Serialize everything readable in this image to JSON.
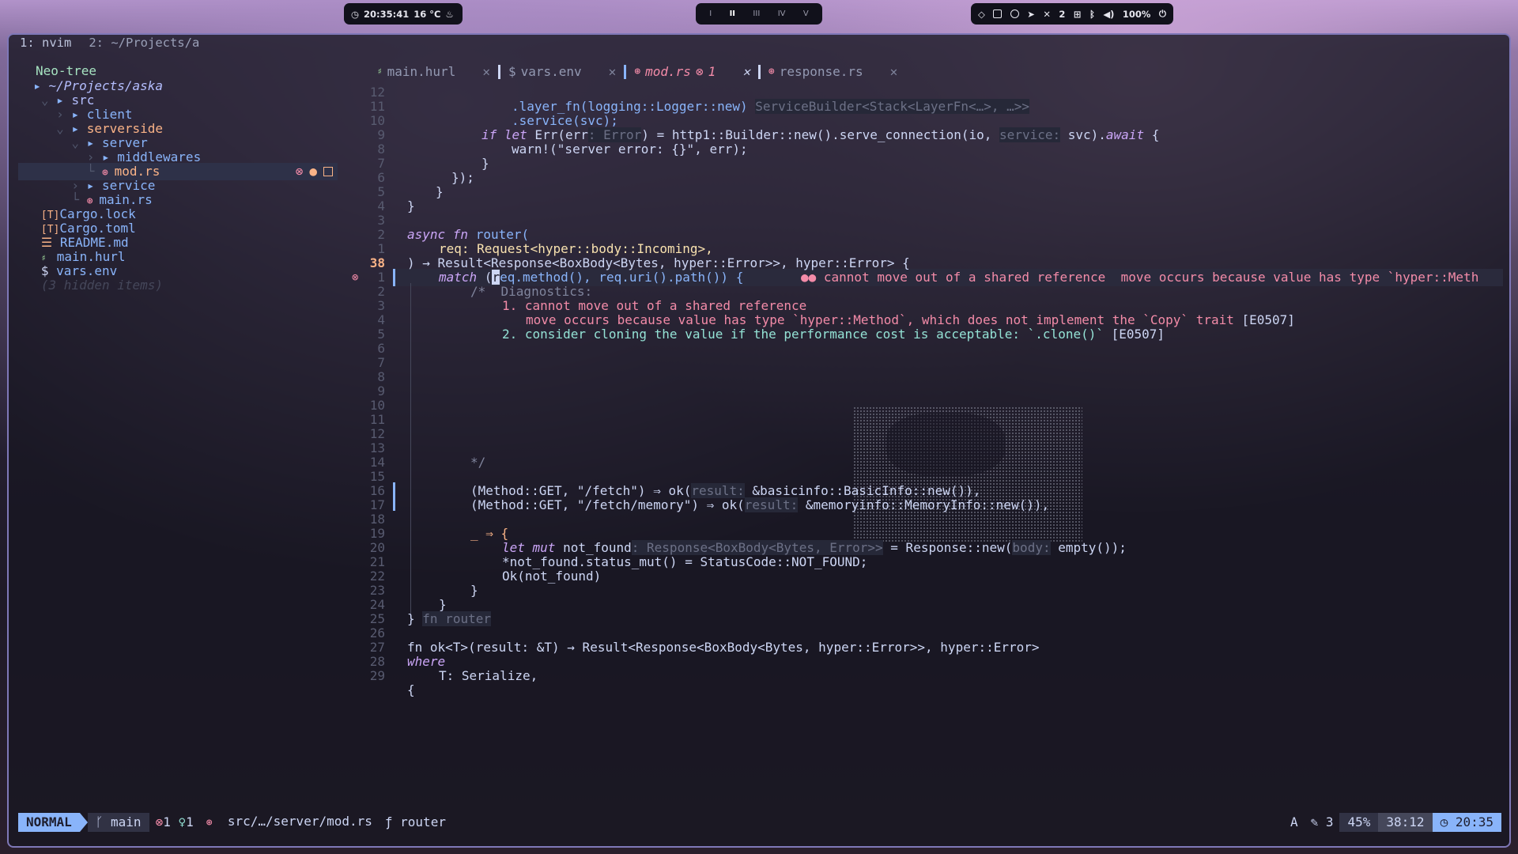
{
  "topbar": {
    "clock": "20:35:41",
    "temp": "16 °C",
    "workspaces": [
      "I",
      "II",
      "III",
      "IV",
      "V"
    ],
    "active_workspace": "II",
    "notif_count": "2",
    "volume": "100%"
  },
  "tmux": {
    "tabs": [
      "1: nvim",
      "2: ~/Projects/a"
    ]
  },
  "tree": {
    "title": "Neo-tree",
    "root": "~/Projects/aska",
    "rows": [
      {
        "name": "src"
      },
      {
        "name": "client"
      },
      {
        "name": "serverside"
      },
      {
        "name": "server"
      },
      {
        "name": "middlewares"
      },
      {
        "name": "mod.rs"
      },
      {
        "name": "service"
      },
      {
        "name": "main.rs"
      },
      {
        "name": "Cargo.lock"
      },
      {
        "name": "Cargo.toml"
      },
      {
        "name": "README.md"
      },
      {
        "name": "main.hurl"
      },
      {
        "name": "vars.env"
      }
    ],
    "hidden": "(3 hidden items)"
  },
  "editor_tabs": [
    {
      "label": "main.hurl"
    },
    {
      "label": "vars.env"
    },
    {
      "label": "mod.rs",
      "errors": "1"
    },
    {
      "label": "response.rs"
    }
  ],
  "line_numbers": [
    "12",
    "11",
    "10",
    "9",
    "8",
    "7",
    "6",
    "5",
    "4",
    "3",
    "2",
    "1",
    "38",
    "1",
    "2",
    "3",
    "4",
    "5",
    "6",
    "7",
    "8",
    "9",
    "10",
    "11",
    "12",
    "13",
    "14",
    "15",
    "16",
    "17",
    "18",
    "19",
    "20",
    "21",
    "22",
    "23",
    "24",
    "25",
    "26",
    "27",
    "28",
    "29"
  ],
  "code": {
    "l1": ".layer_fn(logging::Logger::new)",
    "l1_hint": "ServiceBuilder<Stack<LayerFn<…>, …>>",
    "l2": ".service(svc);",
    "l3a": "if let",
    "l3b": " Err(err",
    "l3c": ": Error",
    "l3d": ") = http1::Builder::new().serve_connection(io, ",
    "l3e": "service:",
    "l3f": " svc).",
    "l3g": "await",
    "l3h": " {",
    "l4": "warn!(\"server error: {}\", err);",
    "l5": "}",
    "l6": "});",
    "l7": "}",
    "l8": "}",
    "l10a": "async fn",
    "l10b": " router(",
    "l11": "req: Request<hyper::body::Incoming>,",
    "l12": ") → Result<Response<BoxBody<Bytes, hyper::Error>>, hyper::Error> {",
    "l13a": "match",
    "l13b": " (",
    "l13c": "r",
    "l13d": "eq.method(), req.uri().path()) {",
    "l13_diag": "●● cannot move out of a shared reference  move occurs because value has type `hyper::Meth",
    "c1": "/*  Diagnostics:",
    "c2": "1. cannot move out of a shared reference",
    "c3": "move occurs because value has type `hyper::Method`, which does not implement the `Copy` trait",
    "c3b": " [E0507]",
    "c4": "2. consider cloning the value if the performance cost is acceptable: `.clone()`",
    "c4b": " [E0507]",
    "c13": "*/",
    "m1a": "(Method::GET, \"/fetch\") ⇒ ok(",
    "m1b": "result:",
    "m1c": " &basicinfo::BasicInfo::new()),",
    "m2a": "(Method::GET, \"/fetch/memory\") ⇒ ok(",
    "m2b": "result:",
    "m2c": " &memoryinfo::MemoryInfo::new()),",
    "w1": "_ ⇒ {",
    "w2a": "let mut",
    "w2b": " not_found",
    "w2c": ": Response<BoxBody<Bytes, Error>>",
    "w2d": " = Response::new(",
    "w2e": "body:",
    "w2f": " empty());",
    "w3": "*not_found.status_mut() = StatusCode::NOT_FOUND;",
    "w4": "Ok(not_found)",
    "w5": "}",
    "w6": "}",
    "w7a": "}",
    "w7b": "fn router",
    "o1": "fn ok<T>(result: &T) → Result<Response<BoxBody<Bytes, hyper::Error>>, hyper::Error>",
    "o2": "where",
    "o3": "T: Serialize,",
    "o4": "{"
  },
  "status": {
    "mode": "NORMAL",
    "branch": "main",
    "errors": "1",
    "hints": "1",
    "path": "src/…/server/mod.rs",
    "symbol": "router",
    "ai": "A",
    "edits": "3",
    "percent": "45%",
    "position": "38:12",
    "time": "20:35"
  }
}
